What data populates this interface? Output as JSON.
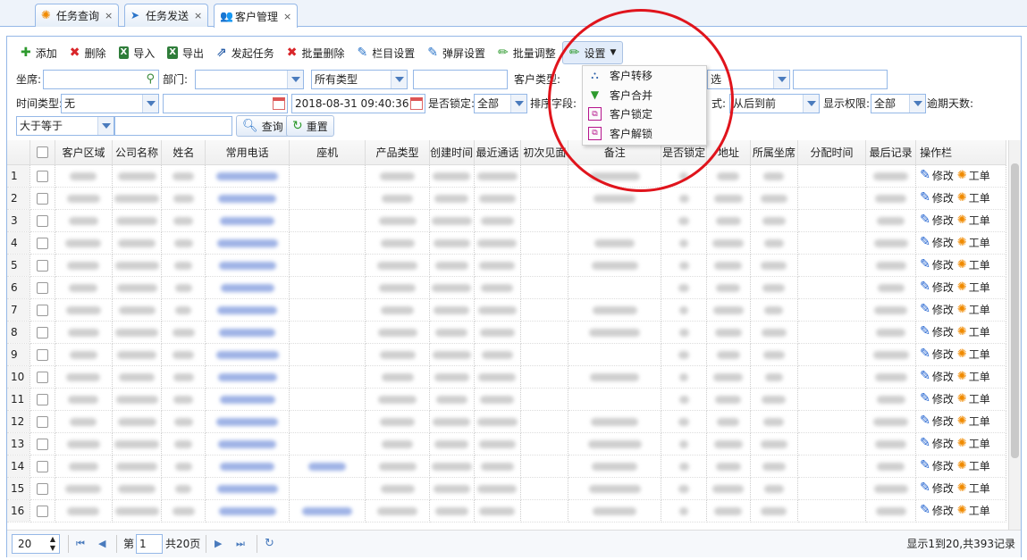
{
  "tabs": [
    {
      "label": "任务查询",
      "close": "×"
    },
    {
      "label": "任务发送",
      "close": "×"
    },
    {
      "label": "客户管理",
      "close": "×"
    }
  ],
  "toolbar": {
    "add": "添加",
    "delete": "删除",
    "import": "导入",
    "export": "导出",
    "start_task": "发起任务",
    "batch_delete": "批量删除",
    "column_settings": "栏目设置",
    "popup_settings": "弹屏设置",
    "batch_adjust": "批量调整",
    "settings": "设置"
  },
  "settings_menu": [
    "客户转移",
    "客户合并",
    "客户锁定",
    "客户解锁"
  ],
  "filters": {
    "seat_label": "坐席:",
    "dept_label": "部门:",
    "type_select": "所有类型",
    "customer_type_label": "客户类型:",
    "customer_type_partial": "选",
    "time_type_label": "时间类型:",
    "time_type_value": "无",
    "date_end": "2018-08-31 09:40:36",
    "locked_label": "是否锁定:",
    "locked_value": "全部",
    "sort_label": "排序字段:",
    "order_label": "式:",
    "order_value": "从后到前",
    "permission_label": "显示权限:",
    "permission_value": "全部",
    "overdue_label": "逾期天数:",
    "compare_value": "大于等于",
    "query_button": "查询",
    "reset_button": "重置"
  },
  "table": {
    "headers": [
      "客户区域",
      "公司名称",
      "姓名",
      "常用电话",
      "座机",
      "产品类型",
      "创建时间",
      "最近通话",
      "初次见面",
      "备注",
      "是否锁定",
      "地址",
      "所属坐席",
      "分配时间",
      "最后记录",
      "操作栏"
    ],
    "row_numbers": [
      "1",
      "2",
      "3",
      "4",
      "5",
      "6",
      "7",
      "8",
      "9",
      "10",
      "11",
      "12",
      "13",
      "14",
      "15",
      "16"
    ],
    "edit_label": "修改",
    "ticket_label": "工单"
  },
  "pager": {
    "page_size": "20",
    "page_prefix": "第",
    "page_value": "1",
    "page_total": "共20页",
    "summary": "显示1到20,共393记录"
  }
}
